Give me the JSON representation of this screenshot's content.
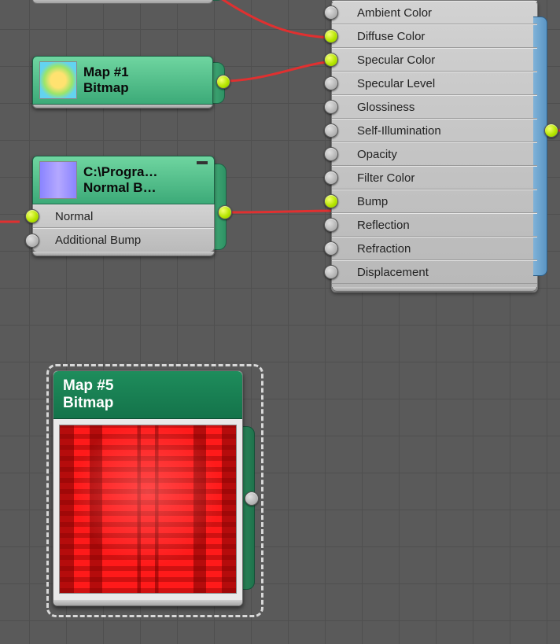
{
  "mat_node": {
    "slots": [
      {
        "label": "Ambient Color",
        "connected": false
      },
      {
        "label": "Diffuse Color",
        "connected": true
      },
      {
        "label": "Specular Color",
        "connected": true
      },
      {
        "label": "Specular Level",
        "connected": false
      },
      {
        "label": "Glossiness",
        "connected": false
      },
      {
        "label": "Self-Illumination",
        "connected": false
      },
      {
        "label": "Opacity",
        "connected": false
      },
      {
        "label": "Filter Color",
        "connected": false
      },
      {
        "label": "Bump",
        "connected": true
      },
      {
        "label": "Reflection",
        "connected": false
      },
      {
        "label": "Refraction",
        "connected": false
      },
      {
        "label": "Displacement",
        "connected": false
      }
    ]
  },
  "map1": {
    "title": "Map #1",
    "subtitle": "Bitmap"
  },
  "map2": {
    "title": "C:\\Progra…",
    "subtitle": "Normal  B…",
    "slots": [
      {
        "label": "Normal",
        "connected": true
      },
      {
        "label": "Additional Bump",
        "connected": false
      }
    ]
  },
  "map5": {
    "title": "Map #5",
    "subtitle": "Bitmap"
  }
}
